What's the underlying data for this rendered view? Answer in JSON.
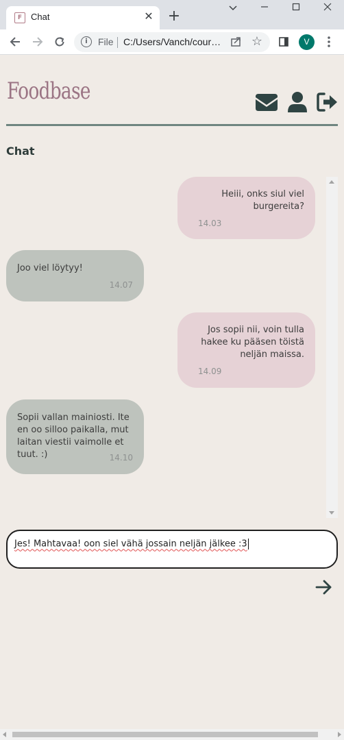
{
  "browser": {
    "tab_title": "Chat",
    "favicon_letter": "F",
    "address_scheme": "File",
    "address_url": "C:/Users/Vanch/courses/foodbase/chat.html",
    "avatar_letter": "V"
  },
  "app": {
    "logo": "Foodbase",
    "page_title": "Chat"
  },
  "messages": [
    {
      "sender": "me",
      "text": "Heiii, onks siul viel burgereita?",
      "time": "14.03"
    },
    {
      "sender": "them",
      "text": "Joo viel löytyy!",
      "time": "14.07"
    },
    {
      "sender": "me",
      "text": "Jos sopii nii, voin tulla hakee ku pääsen töistä neljän maissa.",
      "time": "14.09"
    },
    {
      "sender": "them",
      "text": "Sopii vallan mainiosti. Ite en oo silloo paikalla, mut laitan viestii vaimolle et tuut. :)",
      "time": "14.10"
    }
  ],
  "composer": {
    "value": "Jes! Mahtavaa! oon siel vähä jossain neljän jälkee :3"
  },
  "colors": {
    "background": "#f0ebe6",
    "accent_rule": "#6f8580",
    "logo": "#9b7484",
    "icon": "#2f4443",
    "bubble_me": "#e6d2d6",
    "bubble_them": "#bec3bd"
  },
  "icons": {
    "mail": "envelope-icon",
    "profile": "user-icon",
    "logout": "sign-out-icon",
    "send": "arrow-right-icon"
  }
}
